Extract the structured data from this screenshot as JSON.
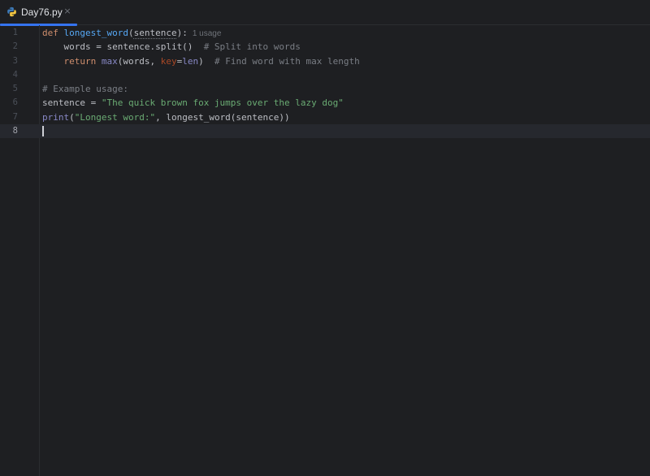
{
  "tab": {
    "filename": "Day76.py",
    "icon": "python-file-icon",
    "close_glyph": "×",
    "accent_color": "#3574f0"
  },
  "editor": {
    "current_line": 8,
    "lines": [
      {
        "n": "1",
        "tokens": [
          {
            "t": "def ",
            "c": "kw"
          },
          {
            "t": "longest_word",
            "c": "fn"
          },
          {
            "t": "(",
            "c": ""
          },
          {
            "t": "sentence",
            "c": "param-underline"
          },
          {
            "t": "):",
            "c": ""
          }
        ],
        "hint": "1 usage"
      },
      {
        "n": "2",
        "tokens": [
          {
            "t": "    words = sentence.split()  ",
            "c": ""
          },
          {
            "t": "# Split into words",
            "c": "cm"
          }
        ]
      },
      {
        "n": "3",
        "tokens": [
          {
            "t": "    ",
            "c": ""
          },
          {
            "t": "return ",
            "c": "kw"
          },
          {
            "t": "max",
            "c": "bi"
          },
          {
            "t": "(words, ",
            "c": ""
          },
          {
            "t": "key",
            "c": "named"
          },
          {
            "t": "=",
            "c": ""
          },
          {
            "t": "len",
            "c": "bi"
          },
          {
            "t": ")  ",
            "c": ""
          },
          {
            "t": "# Find word with max length",
            "c": "cm"
          }
        ]
      },
      {
        "n": "4",
        "tokens": []
      },
      {
        "n": "5",
        "tokens": [
          {
            "t": "# Example usage:",
            "c": "cm"
          }
        ]
      },
      {
        "n": "6",
        "tokens": [
          {
            "t": "sentence = ",
            "c": ""
          },
          {
            "t": "\"The quick brown fox jumps over the lazy dog\"",
            "c": "str"
          }
        ]
      },
      {
        "n": "7",
        "tokens": [
          {
            "t": "print",
            "c": "bi"
          },
          {
            "t": "(",
            "c": ""
          },
          {
            "t": "\"Longest word:\"",
            "c": "str"
          },
          {
            "t": ", longest_word(sentence))",
            "c": ""
          }
        ]
      },
      {
        "n": "8",
        "tokens": []
      }
    ]
  }
}
